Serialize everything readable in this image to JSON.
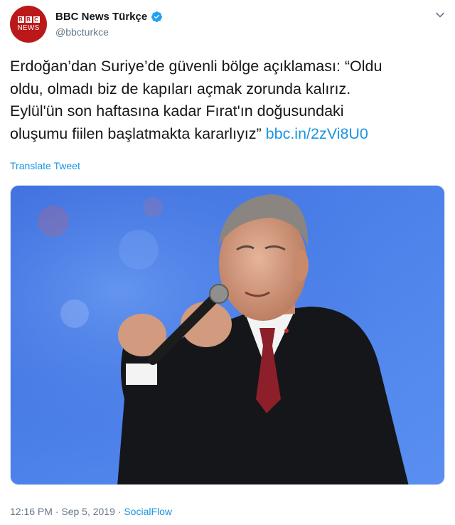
{
  "tweet": {
    "avatar": {
      "logo_letters": [
        "B",
        "B",
        "C"
      ],
      "logo_word": "NEWS"
    },
    "author_name": "BBC News Türkçe",
    "verified_icon": "verified-badge-icon",
    "handle": "@bbcturkce",
    "menu_icon": "chevron-down-icon",
    "text": "Erdoğan’dan Suriye’de güvenli bölge açıklaması: “Oldu\noldu, olmadı biz de kapıları açmak zorunda kalırız.\nEylül'ün son haftasına kadar Fırat'ın doğusundaki\noluşumu fiilen başlatmakta kararlıyız” ",
    "link": "bbc.in/2zVi8U0",
    "translate_label": "Translate Tweet",
    "timestamp": "12:16 PM · Sep 5, 2019 · ",
    "source": "SocialFlow"
  },
  "colors": {
    "brand_red": "#bb1919",
    "link_blue": "#1b95e0",
    "muted_gray": "#657786",
    "photo_background": "#4a7ce8"
  }
}
